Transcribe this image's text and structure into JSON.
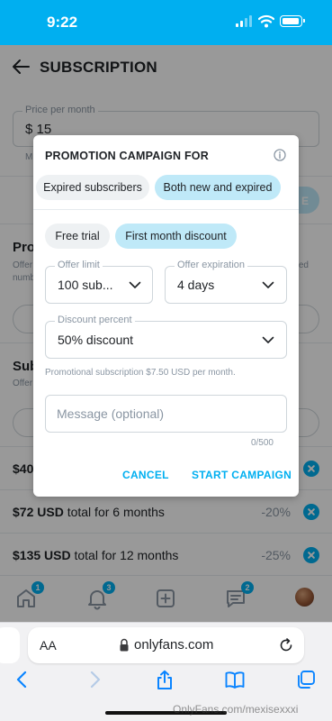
{
  "status_bar": {
    "time": "9:22"
  },
  "app": {
    "title": "SUBSCRIPTION",
    "price": {
      "label": "Price per month",
      "value": "$ 15",
      "note": "M"
    },
    "ghost_button": "E",
    "promotions": {
      "title": "Prot",
      "desc": "Offer",
      "desc2": "numb",
      "desc_right": "ed"
    },
    "bundles_section": {
      "title": "Sub",
      "desc": "Offer"
    },
    "bundles": [
      {
        "price": "$40",
        "total_text": "",
        "discount": ""
      },
      {
        "price": "$72 USD",
        "total_text": " total for 6 months",
        "discount": "-20%"
      },
      {
        "price": "$135 USD",
        "total_text": " total for 12 months",
        "discount": "-25%"
      }
    ],
    "tab_bar": {
      "home_badge": "1",
      "notifications_badge": "3",
      "messages_badge": "2"
    }
  },
  "modal": {
    "title": "PROMOTION CAMPAIGN FOR",
    "audience_options": [
      "Expired subscribers",
      "Both new and expired"
    ],
    "audience_selected": "Both new and expired",
    "type_options": [
      "Free trial",
      "First month discount"
    ],
    "type_selected": "First month discount",
    "offer_limit": {
      "label": "Offer limit",
      "value": "100 sub..."
    },
    "offer_expiration": {
      "label": "Offer expiration",
      "value": "4 days"
    },
    "discount_percent": {
      "label": "Discount percent",
      "value": "50% discount"
    },
    "helper_text": "Promotional subscription $7.50 USD per month.",
    "message": {
      "placeholder": "Message (optional)",
      "value": "",
      "counter": "0/500"
    },
    "cancel_label": "CANCEL",
    "start_label": "START CAMPAIGN"
  },
  "safari": {
    "text_size_label": "AA",
    "url": "onlyfans.com"
  },
  "watermark": "OnlyFans.com/mexisexxxi",
  "colors": {
    "accent": "#00aff0",
    "chip_active": "#bfe9f8",
    "chip_inactive": "#eef1f3"
  }
}
